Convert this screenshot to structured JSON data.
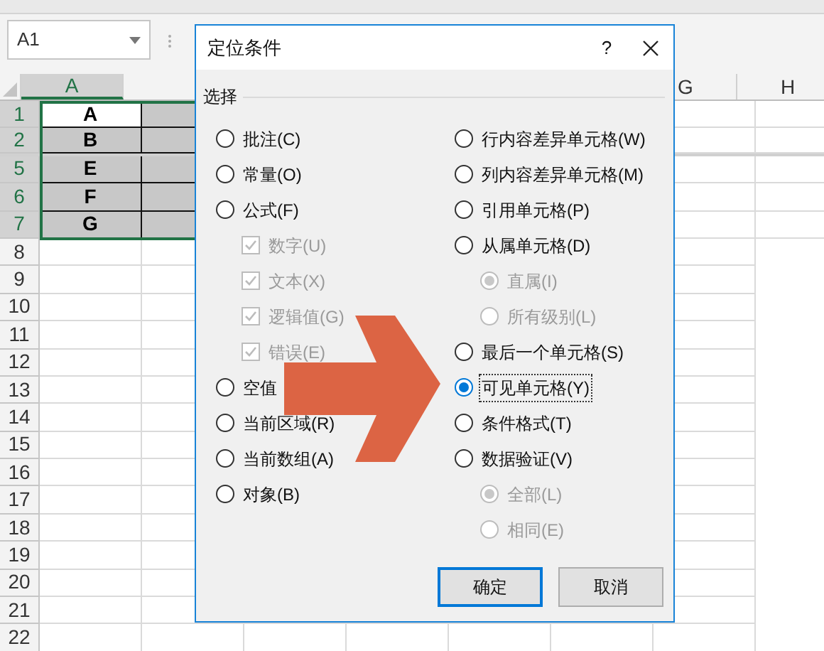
{
  "name_box": {
    "value": "A1"
  },
  "columns": [
    {
      "label": "A",
      "selected": true
    },
    {
      "label": "G",
      "selected": false
    },
    {
      "label": "H",
      "selected": false
    }
  ],
  "rows": [
    {
      "label": "1",
      "selected": true,
      "cells": [
        "A"
      ]
    },
    {
      "label": "2",
      "selected": true,
      "cells": [
        "B"
      ]
    },
    {
      "label": "5",
      "selected": true,
      "cells": [
        "E"
      ]
    },
    {
      "label": "6",
      "selected": true,
      "cells": [
        "F"
      ]
    },
    {
      "label": "7",
      "selected": true,
      "cells": [
        "G"
      ]
    },
    {
      "label": "8",
      "selected": false
    },
    {
      "label": "9",
      "selected": false
    },
    {
      "label": "10",
      "selected": false
    },
    {
      "label": "11",
      "selected": false
    },
    {
      "label": "12",
      "selected": false
    },
    {
      "label": "13",
      "selected": false
    },
    {
      "label": "14",
      "selected": false
    },
    {
      "label": "15",
      "selected": false
    },
    {
      "label": "16",
      "selected": false
    },
    {
      "label": "17",
      "selected": false
    },
    {
      "label": "18",
      "selected": false
    },
    {
      "label": "19",
      "selected": false
    },
    {
      "label": "20",
      "selected": false
    },
    {
      "label": "21",
      "selected": false
    },
    {
      "label": "22",
      "selected": false
    }
  ],
  "dialog": {
    "title": "定位条件",
    "help": "?",
    "group_label": "选择",
    "left_options": [
      {
        "kind": "radio",
        "label": "批注(C)",
        "selected": false,
        "disabled": false
      },
      {
        "kind": "radio",
        "label": "常量(O)",
        "selected": false,
        "disabled": false
      },
      {
        "kind": "radio",
        "label": "公式(F)",
        "selected": false,
        "disabled": false,
        "children": [
          {
            "kind": "checkbox",
            "label": "数字(U)",
            "checked": true,
            "disabled": true
          },
          {
            "kind": "checkbox",
            "label": "文本(X)",
            "checked": true,
            "disabled": true
          },
          {
            "kind": "checkbox",
            "label": "逻辑值(G)",
            "checked": true,
            "disabled": true
          },
          {
            "kind": "checkbox",
            "label": "错误(E)",
            "checked": true,
            "disabled": true
          }
        ]
      },
      {
        "kind": "radio",
        "label": "空值",
        "selected": false,
        "disabled": false
      },
      {
        "kind": "radio",
        "label": "当前区域(R)",
        "selected": false,
        "disabled": false
      },
      {
        "kind": "radio",
        "label": "当前数组(A)",
        "selected": false,
        "disabled": false
      },
      {
        "kind": "radio",
        "label": "对象(B)",
        "selected": false,
        "disabled": false
      }
    ],
    "right_options": [
      {
        "kind": "radio",
        "label": "行内容差异单元格(W)",
        "selected": false,
        "disabled": false
      },
      {
        "kind": "radio",
        "label": "列内容差异单元格(M)",
        "selected": false,
        "disabled": false
      },
      {
        "kind": "radio",
        "label": "引用单元格(P)",
        "selected": false,
        "disabled": false
      },
      {
        "kind": "radio",
        "label": "从属单元格(D)",
        "selected": false,
        "disabled": false,
        "children": [
          {
            "kind": "radio",
            "label": "直属(I)",
            "selected": true,
            "disabled": true
          },
          {
            "kind": "radio",
            "label": "所有级别(L)",
            "selected": false,
            "disabled": true
          }
        ]
      },
      {
        "kind": "radio",
        "label": "最后一个单元格(S)",
        "selected": false,
        "disabled": false
      },
      {
        "kind": "radio",
        "label": "可见单元格(Y)",
        "selected": true,
        "disabled": false
      },
      {
        "kind": "radio",
        "label": "条件格式(T)",
        "selected": false,
        "disabled": false
      },
      {
        "kind": "radio",
        "label": "数据验证(V)",
        "selected": false,
        "disabled": false,
        "children": [
          {
            "kind": "radio",
            "label": "全部(L)",
            "selected": true,
            "disabled": true
          },
          {
            "kind": "radio",
            "label": "相同(E)",
            "selected": false,
            "disabled": true
          }
        ]
      }
    ],
    "buttons": [
      {
        "label": "确定",
        "default": true
      },
      {
        "label": "取消",
        "default": false
      }
    ]
  }
}
